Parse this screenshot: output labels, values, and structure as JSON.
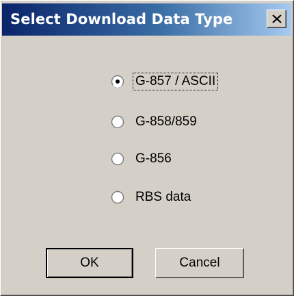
{
  "dialog": {
    "title": "Select Download Data Type",
    "close_icon": "close-x-icon"
  },
  "options": [
    {
      "label": "G-857 / ASCII",
      "selected": true
    },
    {
      "label": "G-858/859",
      "selected": false
    },
    {
      "label": "G-856",
      "selected": false
    },
    {
      "label": "RBS data",
      "selected": false
    }
  ],
  "buttons": {
    "ok_label": "OK",
    "cancel_label": "Cancel"
  },
  "colors": {
    "face": "#d4d0c8",
    "title_start": "#0a246a",
    "title_end": "#a6caf0"
  }
}
